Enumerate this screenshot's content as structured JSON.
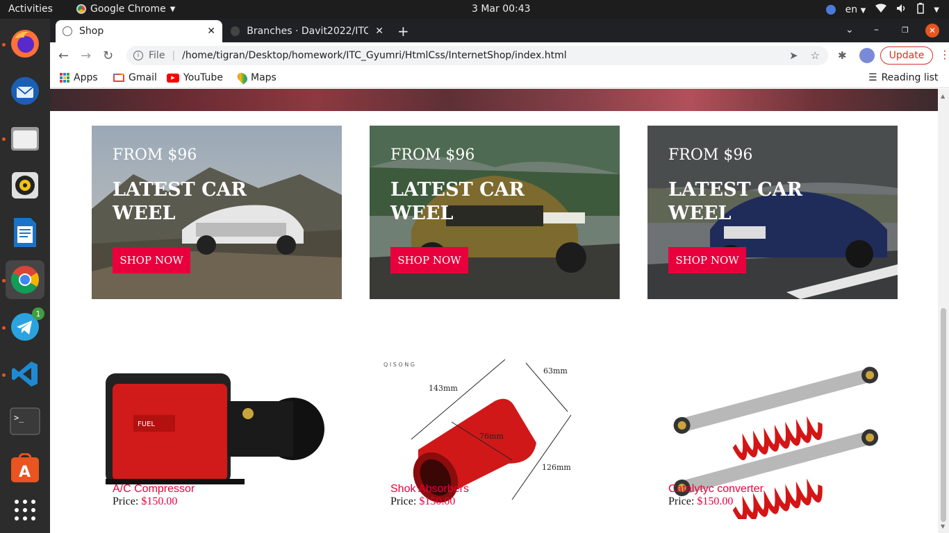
{
  "system": {
    "activities": "Activities",
    "app_name": "Google Chrome",
    "clock": "3 Mar  00:43",
    "lang": "en"
  },
  "dock": {
    "items": [
      "firefox-icon",
      "thunderbird-icon",
      "files-icon",
      "rhythmbox-icon",
      "libreoffice-writer-icon",
      "chrome-icon",
      "telegram-icon",
      "vscode-icon",
      "terminal-icon",
      "software-center-icon",
      "show-apps-icon"
    ],
    "telegram_badge": "1"
  },
  "browser": {
    "tabs": [
      {
        "title": "Shop"
      },
      {
        "title": "Branches · Davit2022/ITC_"
      }
    ],
    "address": {
      "scheme": "File",
      "url": "/home/tigran/Desktop/homework/ITC_Gyumri/HtmlCss/InternetShop/index.html"
    },
    "update_label": "Update",
    "bookmarks": [
      "Apps",
      "Gmail",
      "YouTube",
      "Maps"
    ],
    "reading_list": "Reading list"
  },
  "page": {
    "promo_cards": [
      {
        "from": "FROM $96",
        "title": "LATEST CAR WEEL",
        "button": "SHOP NOW"
      },
      {
        "from": "FROM $96",
        "title": "LATEST CAR WEEL",
        "button": "SHOP NOW"
      },
      {
        "from": "FROM $96",
        "title": "LATEST CAR WEEL",
        "button": "SHOP NOW"
      }
    ],
    "products": [
      {
        "name": "A/C Compressor",
        "price_label": "Price:",
        "price": "$150.00"
      },
      {
        "name": "Shok Absorbers",
        "price_label": "Price:",
        "price": "$150.00"
      },
      {
        "name": "Catalytyc converter",
        "price_label": "Price:",
        "price": "$150.00"
      }
    ],
    "exhaust_dims": {
      "a": "143mm",
      "b": "63mm",
      "c": "76mm",
      "d": "126mm",
      "brand": "Q I S O N G"
    },
    "compressor_brand": "FUEL"
  },
  "colors": {
    "accent": "#e8003d",
    "chrome_dark": "#202124",
    "ubuntu_orange": "#e95420"
  }
}
